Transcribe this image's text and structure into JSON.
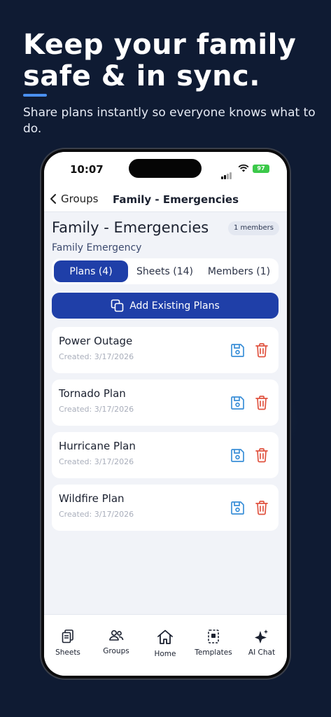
{
  "promo": {
    "headline": "Keep your family safe & in sync.",
    "subhead": "Share plans instantly so everyone knows what to do."
  },
  "status_bar": {
    "time": "10:07",
    "battery": "97"
  },
  "nav": {
    "back_label": "Groups",
    "title": "Family - Emergencies"
  },
  "group": {
    "name": "Family - Emergencies",
    "members_badge": "1 members",
    "subtitle": "Family Emergency"
  },
  "tabs": [
    {
      "label": "Plans (4)",
      "active": true
    },
    {
      "label": "Sheets (14)",
      "active": false
    },
    {
      "label": "Members (1)",
      "active": false
    }
  ],
  "add_button": {
    "label": "Add Existing Plans",
    "icon": "copy-icon"
  },
  "plans": [
    {
      "name": "Power Outage",
      "created": "Created: 3/17/2026"
    },
    {
      "name": "Tornado Plan",
      "created": "Created: 3/17/2026"
    },
    {
      "name": "Hurricane Plan",
      "created": "Created: 3/17/2026"
    },
    {
      "name": "Wildfire Plan",
      "created": "Created: 3/17/2026"
    }
  ],
  "tab_bar": [
    {
      "label": "Sheets",
      "icon": "sheets-icon"
    },
    {
      "label": "Groups",
      "icon": "groups-icon"
    },
    {
      "label": "Home",
      "icon": "home-icon"
    },
    {
      "label": "Templates",
      "icon": "templates-icon"
    },
    {
      "label": "AI Chat",
      "icon": "sparkle-icon"
    }
  ],
  "colors": {
    "background": "#0f1b33",
    "primary": "#1f3fa8",
    "save_icon": "#3a8fd8",
    "trash_icon": "#e0523f",
    "battery": "#3cc94a"
  }
}
